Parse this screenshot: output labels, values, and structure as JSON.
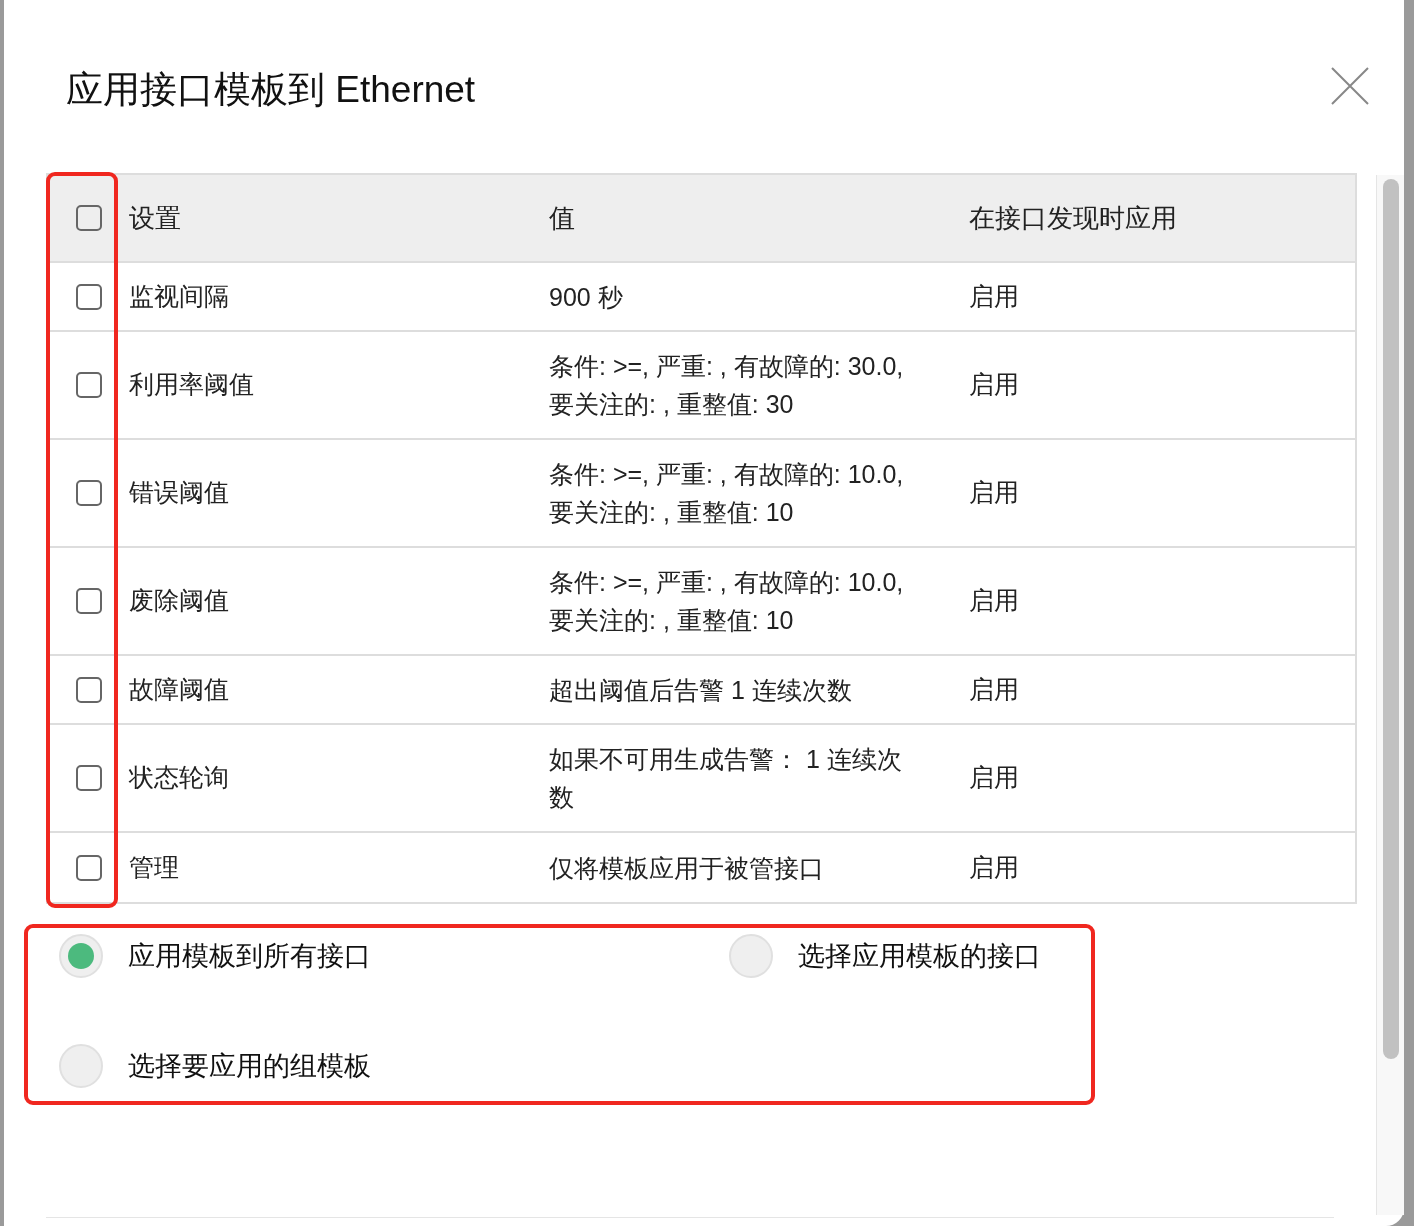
{
  "dialog": {
    "title": "应用接口模板到 Ethernet"
  },
  "table": {
    "select_all": {
      "checked": false
    },
    "columns": [
      "设置",
      "值",
      "在接口发现时应用"
    ],
    "rows": [
      {
        "checked": false,
        "setting": "监视间隔",
        "value_lines": [
          "900 秒"
        ],
        "apply": "启用"
      },
      {
        "checked": false,
        "setting": "利用率阈值",
        "value_lines": [
          "条件: >=, 严重: , 有故障的: 30.0,",
          "要关注的: , 重整值: 30"
        ],
        "apply": "启用"
      },
      {
        "checked": false,
        "setting": "错误阈值",
        "value_lines": [
          "条件: >=, 严重: , 有故障的: 10.0,",
          "要关注的: , 重整值: 10"
        ],
        "apply": "启用"
      },
      {
        "checked": false,
        "setting": "废除阈值",
        "value_lines": [
          "条件: >=, 严重: , 有故障的: 10.0,",
          "要关注的: , 重整值: 10"
        ],
        "apply": "启用"
      },
      {
        "checked": false,
        "setting": "故障阈值",
        "value_lines": [
          "超出阈值后告警 1 连续次数"
        ],
        "apply": "启用"
      },
      {
        "checked": false,
        "setting": "状态轮询",
        "value_lines": [
          "如果不可用生成告警： 1 连续次",
          "数"
        ],
        "apply": "启用"
      },
      {
        "checked": false,
        "setting": "管理",
        "value_lines": [
          "仅将模板应用于被管接口"
        ],
        "apply": "启用"
      }
    ]
  },
  "apply_options": [
    {
      "label": "应用模板到所有接口",
      "selected": true
    },
    {
      "label": "选择应用模板的接口",
      "selected": false
    },
    {
      "label": "选择要应用的组模板",
      "selected": false
    }
  ]
}
